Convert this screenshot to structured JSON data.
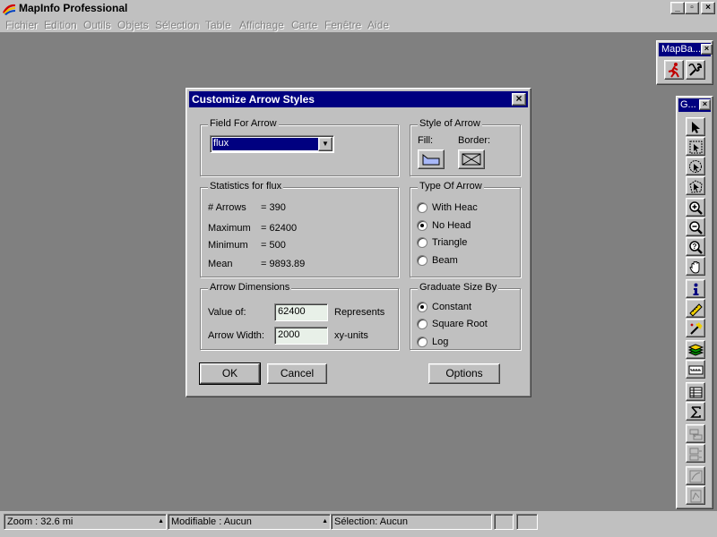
{
  "app": {
    "title": "MapInfo Professional",
    "menu": [
      "Fichier",
      "Edition",
      "Outils",
      "Objets",
      "Sélection",
      "Table",
      "Affichage",
      "Carte",
      "Fenêtre",
      "Aide"
    ],
    "window_controls": {
      "minimize": "_",
      "restore": "▫",
      "close": "×"
    }
  },
  "dialog": {
    "title": "Customize Arrow Styles",
    "field_for_arrow": {
      "label": "Field For Arrow",
      "selected": "flux"
    },
    "style_of_arrow": {
      "label": "Style of Arrow",
      "fill_label": "Fill:",
      "border_label": "Border:"
    },
    "statistics": {
      "label": "Statistics for flux",
      "rows": [
        {
          "name": "# Arrows",
          "value": "= 390"
        },
        {
          "name": "Maximum",
          "value": "= 62400"
        },
        {
          "name": "Minimum",
          "value": "= 500"
        },
        {
          "name": "Mean",
          "value": "= 9893.89"
        }
      ]
    },
    "type_of_arrow": {
      "label": "Type Of Arrow",
      "options": [
        {
          "label": "With Heac",
          "checked": false
        },
        {
          "label": "No Head",
          "checked": true
        },
        {
          "label": "Triangle",
          "checked": false
        },
        {
          "label": "Beam",
          "checked": false
        }
      ]
    },
    "arrow_dimensions": {
      "label": "Arrow Dimensions",
      "value_of_label": "Value of:",
      "value_of": "62400",
      "represents": "Represents",
      "arrow_width_label": "Arrow Width:",
      "arrow_width": "2000",
      "xy_units": "xy-units"
    },
    "graduate": {
      "label": "Graduate Size By",
      "options": [
        {
          "label": "Constant",
          "checked": true
        },
        {
          "label": "Square Root",
          "checked": false
        },
        {
          "label": "Log",
          "checked": false
        }
      ]
    },
    "buttons": {
      "ok": "OK",
      "cancel": "Cancel",
      "options": "Options"
    },
    "close": "×"
  },
  "toolbars": {
    "mapbasic": {
      "title": "MapBa..."
    },
    "general": {
      "title": "G..."
    }
  },
  "statusbar": {
    "zoom": "Zoom : 32.6 mi",
    "editable": "Modifiable : Aucun",
    "selection": "Sélection: Aucun"
  },
  "colors": {
    "desktop": "#808080",
    "title_active": "#000080",
    "face": "#c0c0c0",
    "input_bg": "#e8f0e8",
    "fill_swatch": "#a8b8f8"
  }
}
